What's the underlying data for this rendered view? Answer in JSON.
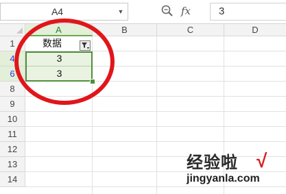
{
  "formula_bar": {
    "cell_reference": "A4",
    "fx_label": "fx",
    "formula_value": "3"
  },
  "columns": [
    "A",
    "B",
    "C",
    "D"
  ],
  "rows": [
    "1",
    "4",
    "6",
    "8",
    "9",
    "10",
    "11",
    "12",
    "13",
    "14"
  ],
  "cells": {
    "a1": "数据",
    "a4": "3",
    "a6": "3"
  },
  "colors": {
    "selection": "#4f8f3a",
    "annotation_circle": "#e0161b",
    "filtered_row_number": "#2b3fd6"
  },
  "watermark": {
    "text_cn": "经验啦",
    "check_mark": "√",
    "url": "jingyanla.com"
  }
}
